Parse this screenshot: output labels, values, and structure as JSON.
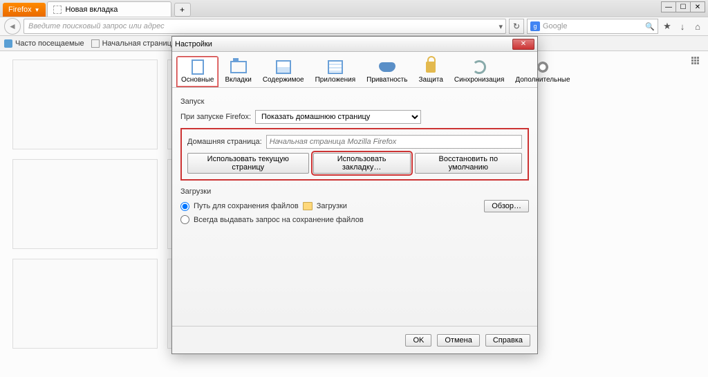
{
  "browser": {
    "menu_label": "Firefox",
    "tab_title": "Новая вкладка",
    "url_placeholder": "Введите поисковый запрос или адрес",
    "search_engine": "Google",
    "bookmarks_bar": {
      "most_visited": "Часто посещаемые",
      "start_page": "Начальная страница"
    }
  },
  "dialog": {
    "title": "Настройки",
    "tabs": {
      "general": "Основные",
      "tabs": "Вкладки",
      "content": "Содержимое",
      "apps": "Приложения",
      "privacy": "Приватность",
      "security": "Защита",
      "sync": "Синхронизация",
      "advanced": "Дополнительные"
    },
    "startup": {
      "section": "Запуск",
      "when_start_label": "При запуске Firefox:",
      "when_start_value": "Показать домашнюю страницу"
    },
    "homepage": {
      "label": "Домашняя страница:",
      "placeholder": "Начальная страница Mozilla Firefox",
      "use_current": "Использовать текущую страницу",
      "use_bookmark": "Использовать закладку…",
      "restore_default": "Восстановить по умолчанию"
    },
    "downloads": {
      "section": "Загрузки",
      "save_path_label": "Путь для сохранения файлов",
      "folder": "Загрузки",
      "browse": "Обзор…",
      "always_ask": "Всегда выдавать запрос на сохранение файлов"
    },
    "footer": {
      "ok": "OK",
      "cancel": "Отмена",
      "help": "Справка"
    }
  }
}
